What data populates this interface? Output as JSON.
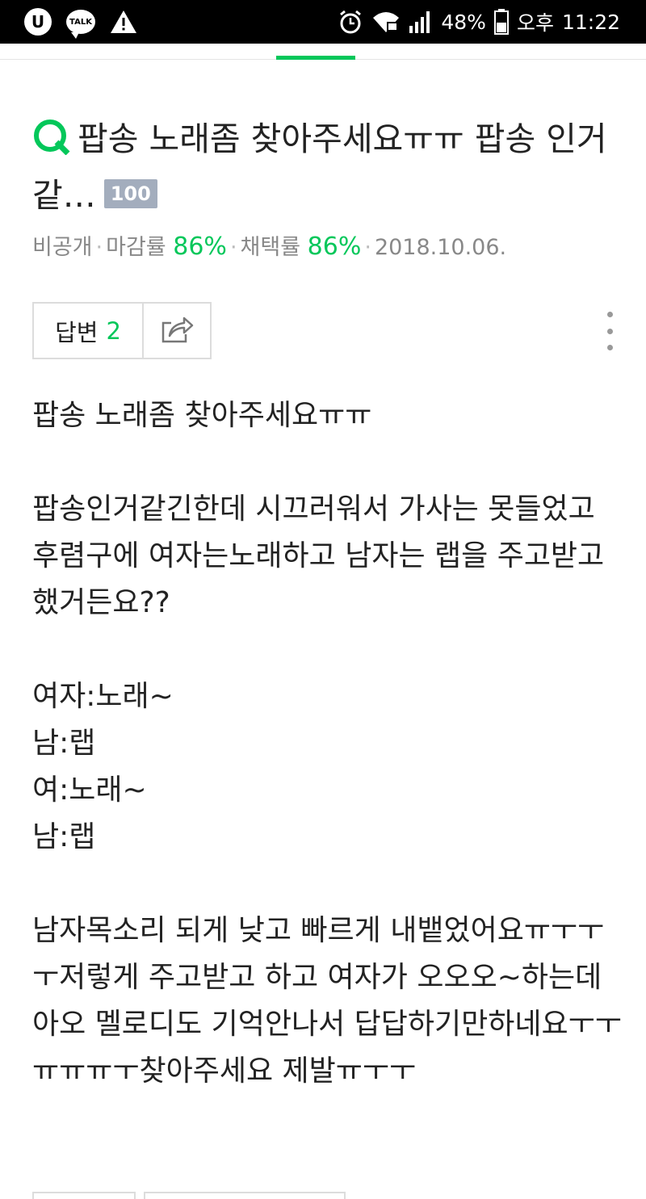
{
  "status_bar": {
    "left_icons": [
      "u-plus-icon",
      "kakaotalk-icon",
      "warning-icon"
    ],
    "talk_label": "TALK",
    "u_label": "U",
    "battery": "48%",
    "ampm": "오후",
    "time": "11:22"
  },
  "question": {
    "title": "팝송 노래좀 찾아주세요ㅠㅠ 팝송 인거같…",
    "points_badge": "100",
    "meta": {
      "visibility": "비공개",
      "close_rate_label": "마감률",
      "close_rate": "86%",
      "adopt_rate_label": "채택률",
      "adopt_rate": "86%",
      "date": "2018.10.06."
    },
    "answer_label": "답변",
    "answer_count": "2",
    "body": "팝송 노래좀 찾아주세요ㅠㅠ\n\n팝송인거같긴한데 시끄러워서 가사는 못들었고 후렴구에 여자는노래하고 남자는 랩을 주고받고했거든요??\n\n여자:노래~\n남:랩\n여:노래~\n남:랩\n\n남자목소리 되게 낮고 빠르게 내뱉었어요ㅠㅜㅜㅜ저렇게 주고받고 하고 여자가 오오오~하는데 아오 멜로디도 기억안나서 답답하기만하네요ㅜㅜㅠㅠㅠㅜ찾아주세요 제발ㅠㅜㅜ"
  },
  "colors": {
    "accent": "#03c75a",
    "badge": "#a3adbd",
    "meta_text": "#888888"
  }
}
